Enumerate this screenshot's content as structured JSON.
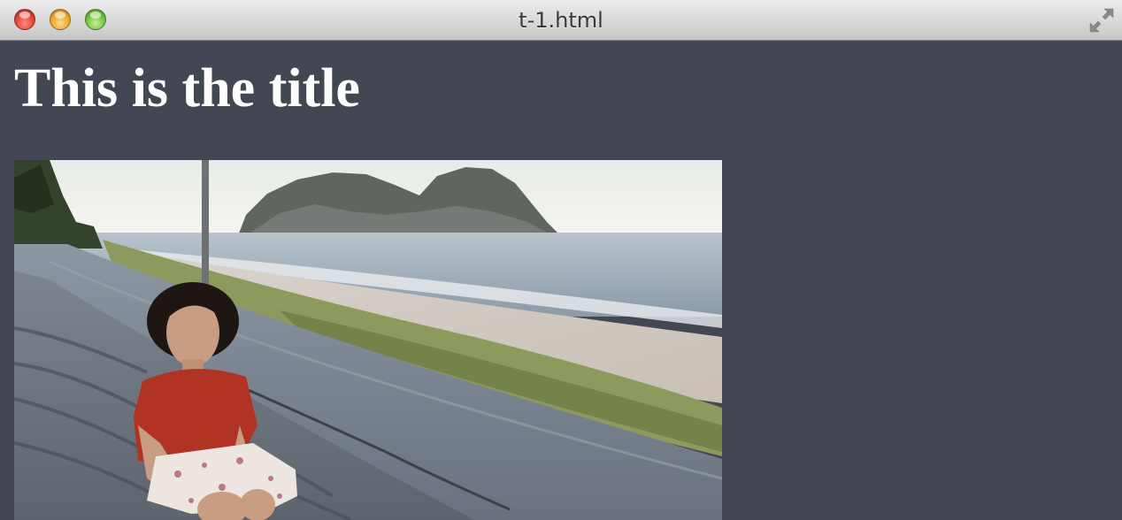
{
  "window": {
    "title": "t-1.html",
    "controls": [
      "close-button",
      "minimize-button",
      "zoom-button",
      "fullscreen-button"
    ]
  },
  "page": {
    "heading": "This is the title",
    "background_color": "#434753",
    "heading_color": "#ffffff"
  },
  "image": {
    "alt": "Girl in a red shirt sitting in a concrete boat by the beach"
  }
}
